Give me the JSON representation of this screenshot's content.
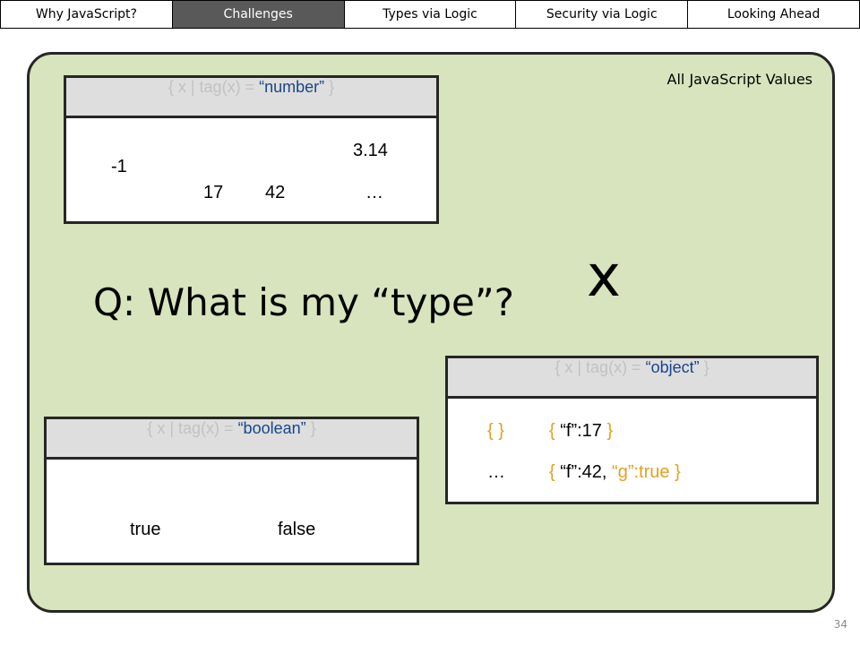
{
  "nav": {
    "tabs": [
      {
        "label": "Why JavaScript?",
        "active": false
      },
      {
        "label": "Challenges",
        "active": true
      },
      {
        "label": "Types via Logic",
        "active": false
      },
      {
        "label": "Security via Logic",
        "active": false
      },
      {
        "label": "Looking Ahead",
        "active": false
      }
    ]
  },
  "universe": {
    "label": "All JavaScript Values"
  },
  "number_set": {
    "header_prefix": "{ x | tag(x) = ",
    "header_tag": "“number”",
    "header_suffix": " }",
    "values": [
      "-1",
      "3.14",
      "17",
      "42",
      "…"
    ]
  },
  "boolean_set": {
    "header_prefix": "{ x | tag(x) = ",
    "header_tag": "“boolean”",
    "header_suffix": " }",
    "values": [
      "true",
      "false"
    ]
  },
  "object_set": {
    "header_prefix": "{ x | tag(x) = ",
    "header_tag": "“object”",
    "header_suffix": " }",
    "empty_object": "{ }",
    "ellipsis": "…",
    "obj1": {
      "open": "{ ",
      "body": "“f”:17",
      "close": " }"
    },
    "obj2": {
      "open": "{ ",
      "body1": "“f”:42, ",
      "body2": "“g”:true",
      "close": " }"
    }
  },
  "question": "Q: What is my “type”?",
  "x_mark": "x",
  "slide_number": "34",
  "colors": {
    "panel": "#d7e4bd",
    "active_tab": "#595959",
    "object_brace": "#e3a020",
    "tag_text": "#17468b"
  }
}
